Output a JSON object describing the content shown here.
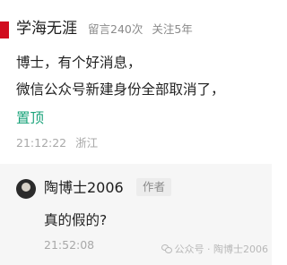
{
  "comment": {
    "username": "学海无涯",
    "stats": {
      "comments": "留言240次",
      "following": "关注5年"
    },
    "body_lines": [
      "博士，有个好消息，",
      "微信公众号新建身份全部取消了，"
    ],
    "pin_label": "置顶",
    "time": "21:12:22",
    "location": "浙江"
  },
  "reply": {
    "username": "陶博士2006",
    "author_badge": "作者",
    "text": "真的假的?",
    "time": "21:52:08"
  },
  "watermark": {
    "text": "公众号 · 陶博士2006",
    "icon": "wechat-icon"
  }
}
